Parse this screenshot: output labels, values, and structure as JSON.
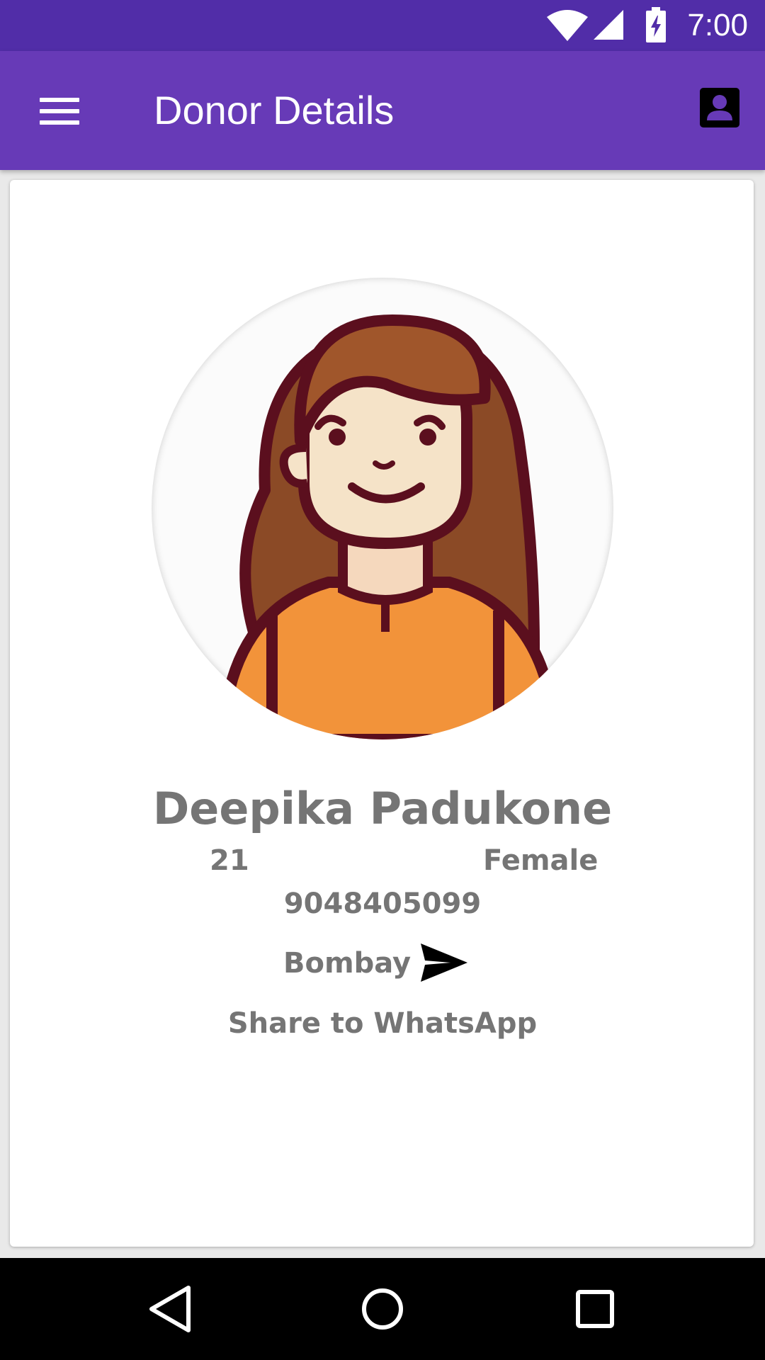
{
  "status_bar": {
    "time": "7:00",
    "icons": [
      "wifi-icon",
      "cell-signal-icon",
      "battery-charging-icon"
    ]
  },
  "app_bar": {
    "title": "Donor Details",
    "menu_icon": "hamburger-menu-icon",
    "profile_icon": "account-box-icon"
  },
  "donor": {
    "avatar": "female-avatar-illustration",
    "name": "Deepika Padukone",
    "age": "21",
    "gender": "Female",
    "phone": "9048405099",
    "city": "Bombay",
    "share_label": "Share to WhatsApp"
  },
  "colors": {
    "status_bar": "#512da8",
    "app_bar": "#673ab7",
    "text": "#757575"
  },
  "nav_bar": [
    "back-icon",
    "home-icon",
    "recents-icon"
  ]
}
